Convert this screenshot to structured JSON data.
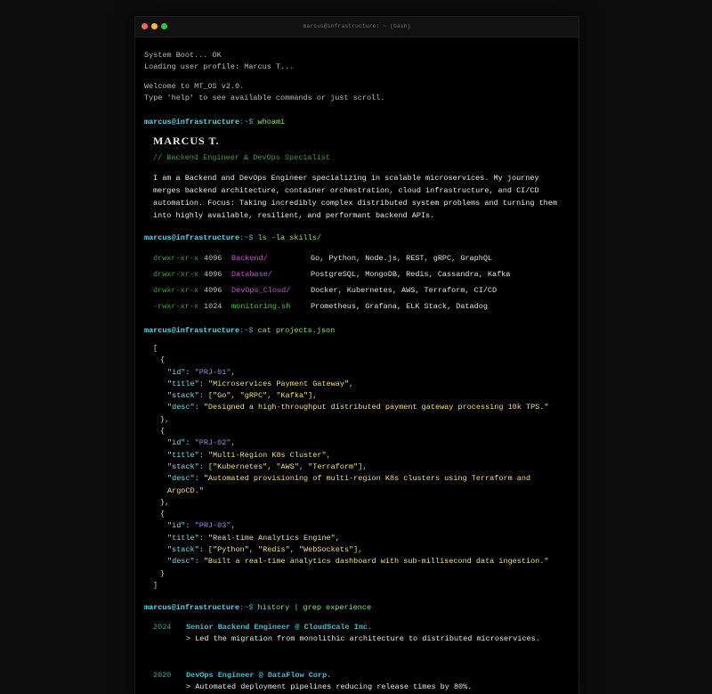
{
  "window": {
    "title": "marcus@infrastructure: ~ (bash)"
  },
  "boot": [
    "System Boot... OK",
    "Loading user profile: Marcus T..."
  ],
  "welcome": [
    "Welcome to MT_OS v2.0.",
    "Type 'help' to see available commands or just scroll."
  ],
  "prompt": {
    "user": "marcus@infrastructure",
    "dir": ":~$"
  },
  "commands": {
    "whoami": "whoami",
    "skills": "ls -la skills/",
    "projects": "cat projects.json",
    "history": "history | grep experience"
  },
  "profile": {
    "name": "MARCUS T.",
    "role": "// Backend Engineer & DevOps Specialist",
    "bio": "I am a Backend and DevOps Engineer specializing in scalable microservices. My journey merges backend architecture, container orchestration, cloud infrastructure, and CI/CD automation. Focus: Taking incredibly complex distributed system problems and turning them into highly available, resilient, and performant backend APIs."
  },
  "skills": [
    {
      "perm": "drwxr-xr-x",
      "size": "4096",
      "name": "Backend/",
      "type": "dir",
      "tech": "Go, Python, Node.js, REST, gRPC, GraphQL"
    },
    {
      "perm": "drwxr-xr-x",
      "size": "4096",
      "name": "Database/",
      "type": "dir",
      "tech": "PostgreSQL, MongoDB, Redis, Cassandra, Kafka"
    },
    {
      "perm": "drwxr-xr-x",
      "size": "4096",
      "name": "DevOps_Cloud/",
      "type": "dir",
      "tech": "Docker, Kubernetes, AWS, Terraform, CI/CD"
    },
    {
      "perm": "-rwxr-xr-x",
      "size": "1024",
      "name": "monitoring.sh",
      "type": "file",
      "tech": "Prometheus, Grafana, ELK Stack, Datadog"
    }
  ],
  "projects": [
    {
      "id": "PRJ-01",
      "title": "Microservices Payment Gateway",
      "stack": "[\"Go\", \"gRPC\", \"Kafka\"]",
      "desc": "Designed a high-throughput distributed payment gateway processing 10k TPS."
    },
    {
      "id": "PRJ-02",
      "title": "Multi-Region K8s Cluster",
      "stack": "[\"Kubernetes\", \"AWS\", \"Terraform\"]",
      "desc": "Automated provisioning of multi-region K8s clusters using Terraform and ArgoCD."
    },
    {
      "id": "PRJ-03",
      "title": "Real-time Analytics Engine",
      "stack": "[\"Python\", \"Redis\", \"WebSockets\"]",
      "desc": "Built a real-time analytics dashboard with sub-millisecond data ingestion."
    }
  ],
  "experience": [
    {
      "year": "2024",
      "title": "Senior Backend Engineer @ CloudScale Inc.",
      "desc": "> Led the migration from monolithic architecture to distributed microservices."
    },
    {
      "year": "2020",
      "title": "DevOps Engineer @ DataFlow Corp.",
      "desc": "> Automated deployment pipelines reducing release times by 80%."
    }
  ]
}
